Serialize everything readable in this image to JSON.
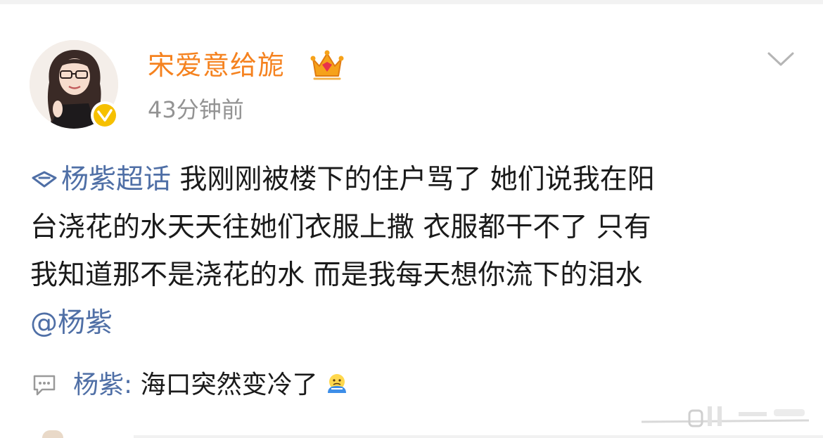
{
  "post": {
    "author": {
      "name": "宋爱意给旎",
      "avatar_icon": "user-avatar",
      "verified_icon": "verified-check-icon",
      "vip_icon": "crown-icon",
      "name_color": "#f5821f"
    },
    "time": "43分钟前",
    "more_icon": "chevron-down-icon",
    "topic": "杨紫超话",
    "body_lines": [
      " 我刚刚被楼下的住户骂了 她们说我在阳",
      "台浇花的水天天往她们衣服上撒 衣服都干不了 只有",
      "我知道那不是浇花的水 而是我每天想你流下的泪水"
    ],
    "mention": "@杨紫",
    "link_color": "#4f6fa6"
  },
  "comment": {
    "icon": "comment-icon",
    "user": "杨紫",
    "separator": ":",
    "text": " 海口突然变冷了",
    "emoji": "cold-face-emoji"
  }
}
